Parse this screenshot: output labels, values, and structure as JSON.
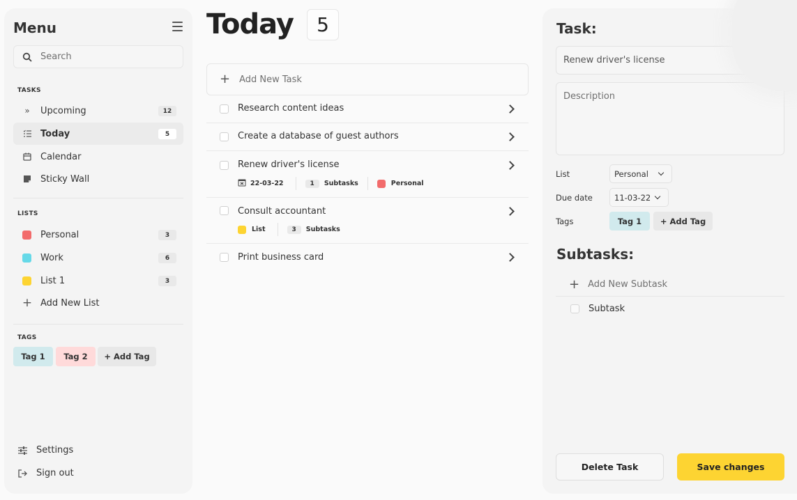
{
  "sidebar": {
    "title": "Menu",
    "search_placeholder": "Search",
    "tasks_label": "TASKS",
    "tasks": [
      {
        "label": "Upcoming",
        "count": "12"
      },
      {
        "label": "Today",
        "count": "5"
      },
      {
        "label": "Calendar"
      },
      {
        "label": "Sticky Wall"
      }
    ],
    "lists_label": "LISTS",
    "lists": [
      {
        "label": "Personal",
        "count": "3",
        "color": "#f26b6b"
      },
      {
        "label": "Work",
        "count": "6",
        "color": "#66d9e8"
      },
      {
        "label": "List 1",
        "count": "3",
        "color": "#fdd432"
      }
    ],
    "add_list": "Add New List",
    "tags_label": "TAGS",
    "tags": [
      {
        "label": "Tag 1",
        "color": "#d1eaed"
      },
      {
        "label": "Tag 2",
        "color": "#ffdada"
      }
    ],
    "add_tag": "+ Add Tag",
    "settings": "Settings",
    "sign_out": "Sign out"
  },
  "main": {
    "title": "Today",
    "count": "5",
    "add_task": "Add New Task",
    "tasks": [
      {
        "title": "Research content ideas"
      },
      {
        "title": "Create a database of guest authors"
      },
      {
        "title": "Renew driver's license",
        "date": "22-03-22",
        "subtasks_count": "1",
        "subtasks_label": "Subtasks",
        "list": "Personal",
        "list_color": "#f26b6b"
      },
      {
        "title": "Consult accountant",
        "list": "List",
        "list_color": "#fdd432",
        "subtasks_count": "3",
        "subtasks_label": "Subtasks"
      },
      {
        "title": "Print business card"
      }
    ]
  },
  "panel": {
    "title": "Task:",
    "task_name": "Renew driver's license",
    "description_placeholder": "Description",
    "list_label": "List",
    "list_value": "Personal",
    "due_label": "Due date",
    "due_value": "11-03-22",
    "tags_label": "Tags",
    "tag": "Tag 1",
    "add_tag": "+ Add Tag",
    "subtasks_title": "Subtasks:",
    "add_subtask": "Add New Subtask",
    "subtask": "Subtask",
    "delete": "Delete Task",
    "save": "Save changes"
  },
  "colors": {
    "accent": "#fdd432"
  }
}
